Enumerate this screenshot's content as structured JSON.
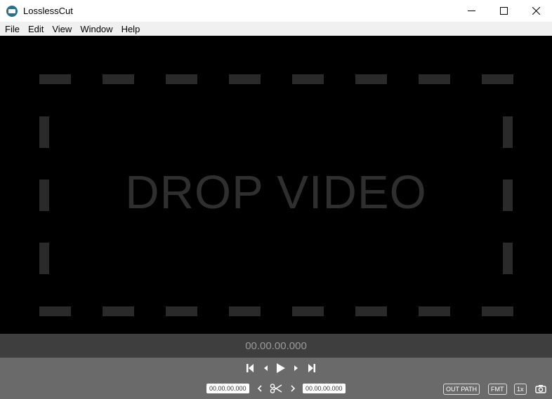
{
  "window": {
    "title": "LosslessCut"
  },
  "menubar": {
    "items": [
      "File",
      "Edit",
      "View",
      "Window",
      "Help"
    ]
  },
  "drop": {
    "text": "DROP VIDEO"
  },
  "timeline": {
    "current_time": "00.00.00.000"
  },
  "controls": {
    "cut_start": "00.00.00.000",
    "cut_end": "00.00.00.000",
    "out_path_label": "OUT PATH",
    "format_label": "FMT",
    "speed_label": "1x"
  },
  "colors": {
    "title_bg": "#ffffff",
    "menubar_bg": "#f0f0f0",
    "drop_bg": "#000000",
    "dash_color": "#2a2a2a",
    "timebar_bg": "#3e3e3e",
    "controls_bg": "#6a6a6a"
  }
}
